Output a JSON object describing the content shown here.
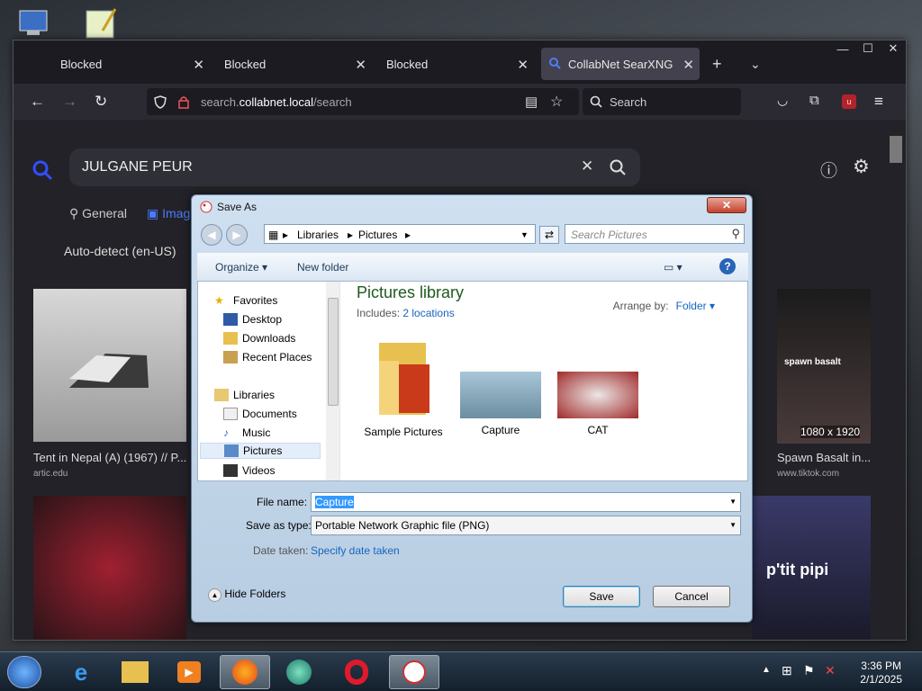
{
  "browser": {
    "tabs": [
      {
        "label": "Blocked"
      },
      {
        "label": "Blocked"
      },
      {
        "label": "Blocked"
      },
      {
        "label": "CollabNet SearXNG",
        "active": true
      }
    ],
    "url": {
      "pre": "search.",
      "host": "collabnet.local",
      "path": "/search"
    },
    "search_placeholder": "Search",
    "page": {
      "query": "JULGANE PEUR",
      "categories": [
        "General",
        "Imag"
      ],
      "autodetect": "Auto-detect (en-US)",
      "results": [
        {
          "caption": "Tent in Nepal (A) (1967) // P...",
          "source": "artic.edu"
        },
        {
          "caption": "Spawn Basalt in...",
          "source": "www.tiktok.com",
          "size": "1080 x 1920",
          "overlay": "spawn basalt"
        },
        {
          "overlay": "p'tit pipi"
        }
      ]
    }
  },
  "dialog": {
    "title": "Save As",
    "breadcrumb": [
      "Libraries",
      "Pictures"
    ],
    "search_placeholder": "Search Pictures",
    "toolbar": {
      "organize": "Organize",
      "new_folder": "New folder"
    },
    "nav": [
      {
        "label": "Favorites",
        "icon": "star-icon"
      },
      {
        "label": "Desktop",
        "icon": "desktop-icon"
      },
      {
        "label": "Downloads",
        "icon": "downloads-icon"
      },
      {
        "label": "Recent Places",
        "icon": "recent-icon"
      },
      {
        "label": "Libraries",
        "icon": "library-icon"
      },
      {
        "label": "Documents",
        "icon": "documents-icon"
      },
      {
        "label": "Music",
        "icon": "music-icon"
      },
      {
        "label": "Pictures",
        "icon": "pictures-icon",
        "selected": true
      },
      {
        "label": "Videos",
        "icon": "videos-icon"
      }
    ],
    "library": {
      "title": "Pictures library",
      "includes_label": "Includes:",
      "includes_link": "2 locations",
      "arrange_label": "Arrange by:",
      "arrange_value": "Folder"
    },
    "files": [
      {
        "label": "Sample Pictures"
      },
      {
        "label": "Capture"
      },
      {
        "label": "CAT"
      }
    ],
    "fields": {
      "filename_label": "File name:",
      "filename_value": "Capture",
      "type_label": "Save as type:",
      "type_value": "Portable Network Graphic file (PNG)",
      "date_label": "Date taken:",
      "date_link": "Specify date taken"
    },
    "hide_folders": "Hide Folders",
    "save": "Save",
    "cancel": "Cancel"
  },
  "taskbar": {
    "time": "3:36 PM",
    "date": "2/1/2025",
    "apps": [
      "ie-icon",
      "explorer-icon",
      "media-player-icon",
      "firefox-icon",
      "app-icon",
      "opera-icon",
      "paint-icon"
    ]
  },
  "colors": {
    "accent": "#3399ff",
    "browser_bg": "#1c1b22",
    "dialog_frame": "#b8cde2"
  }
}
